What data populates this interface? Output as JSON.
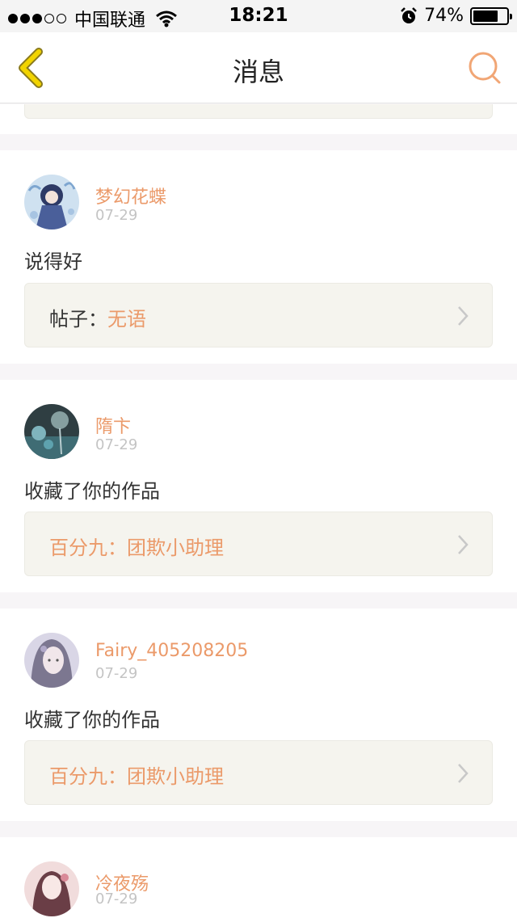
{
  "status_bar": {
    "carrier": "中国联通",
    "time": "18:21",
    "battery_pct": "74%",
    "battery_level": 0.74,
    "signal_filled": 3,
    "signal_total": 5
  },
  "nav": {
    "title": "消息",
    "back_icon": "chevron-left-icon",
    "search_icon": "search-icon"
  },
  "colors": {
    "accent": "#eb9a6a",
    "back_icon": "#f2d400",
    "search_icon": "#f1a675",
    "ref_bg": "#f5f4ee"
  },
  "messages": [
    {
      "user": "梦幻花蝶",
      "date": "07-29",
      "text": "说得好",
      "ref_prefix": "帖子：",
      "ref_title": "无语"
    },
    {
      "user": "隋卞",
      "date": "07-29",
      "text": "收藏了你的作品",
      "ref_prefix": "",
      "ref_title": "百分九：团欺小助理"
    },
    {
      "user": "Fairy_405208205",
      "date": "07-29",
      "text": "收藏了你的作品",
      "ref_prefix": "",
      "ref_title": "百分九：团欺小助理"
    },
    {
      "user": "冷夜殇",
      "date": "07-29"
    }
  ]
}
